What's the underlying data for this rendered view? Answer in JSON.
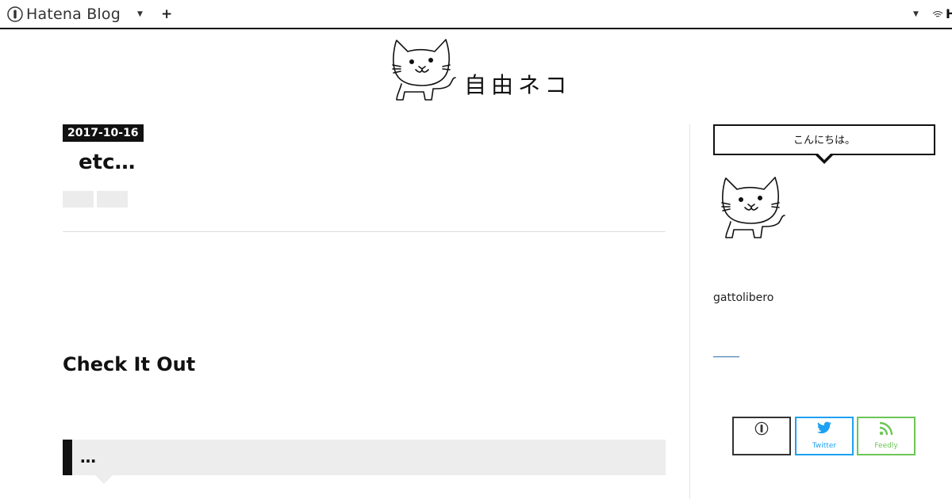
{
  "topbar": {
    "logo_text": "Hatena Blog",
    "right_label": "H"
  },
  "header": {
    "blog_title": "自由ネコ"
  },
  "entry": {
    "date": "2017-10-16",
    "title": "etc…",
    "section_heading": "Check It Out",
    "comment_text": "…"
  },
  "sidebar": {
    "about_title": "こんにちは。",
    "author_name": "gattolibero"
  },
  "share": {
    "twitter_label": "Twitter",
    "feedly_label": "Feedly"
  },
  "colors": {
    "twitter": "#1da1f2",
    "feedly": "#6cc655",
    "text": "#111111"
  }
}
